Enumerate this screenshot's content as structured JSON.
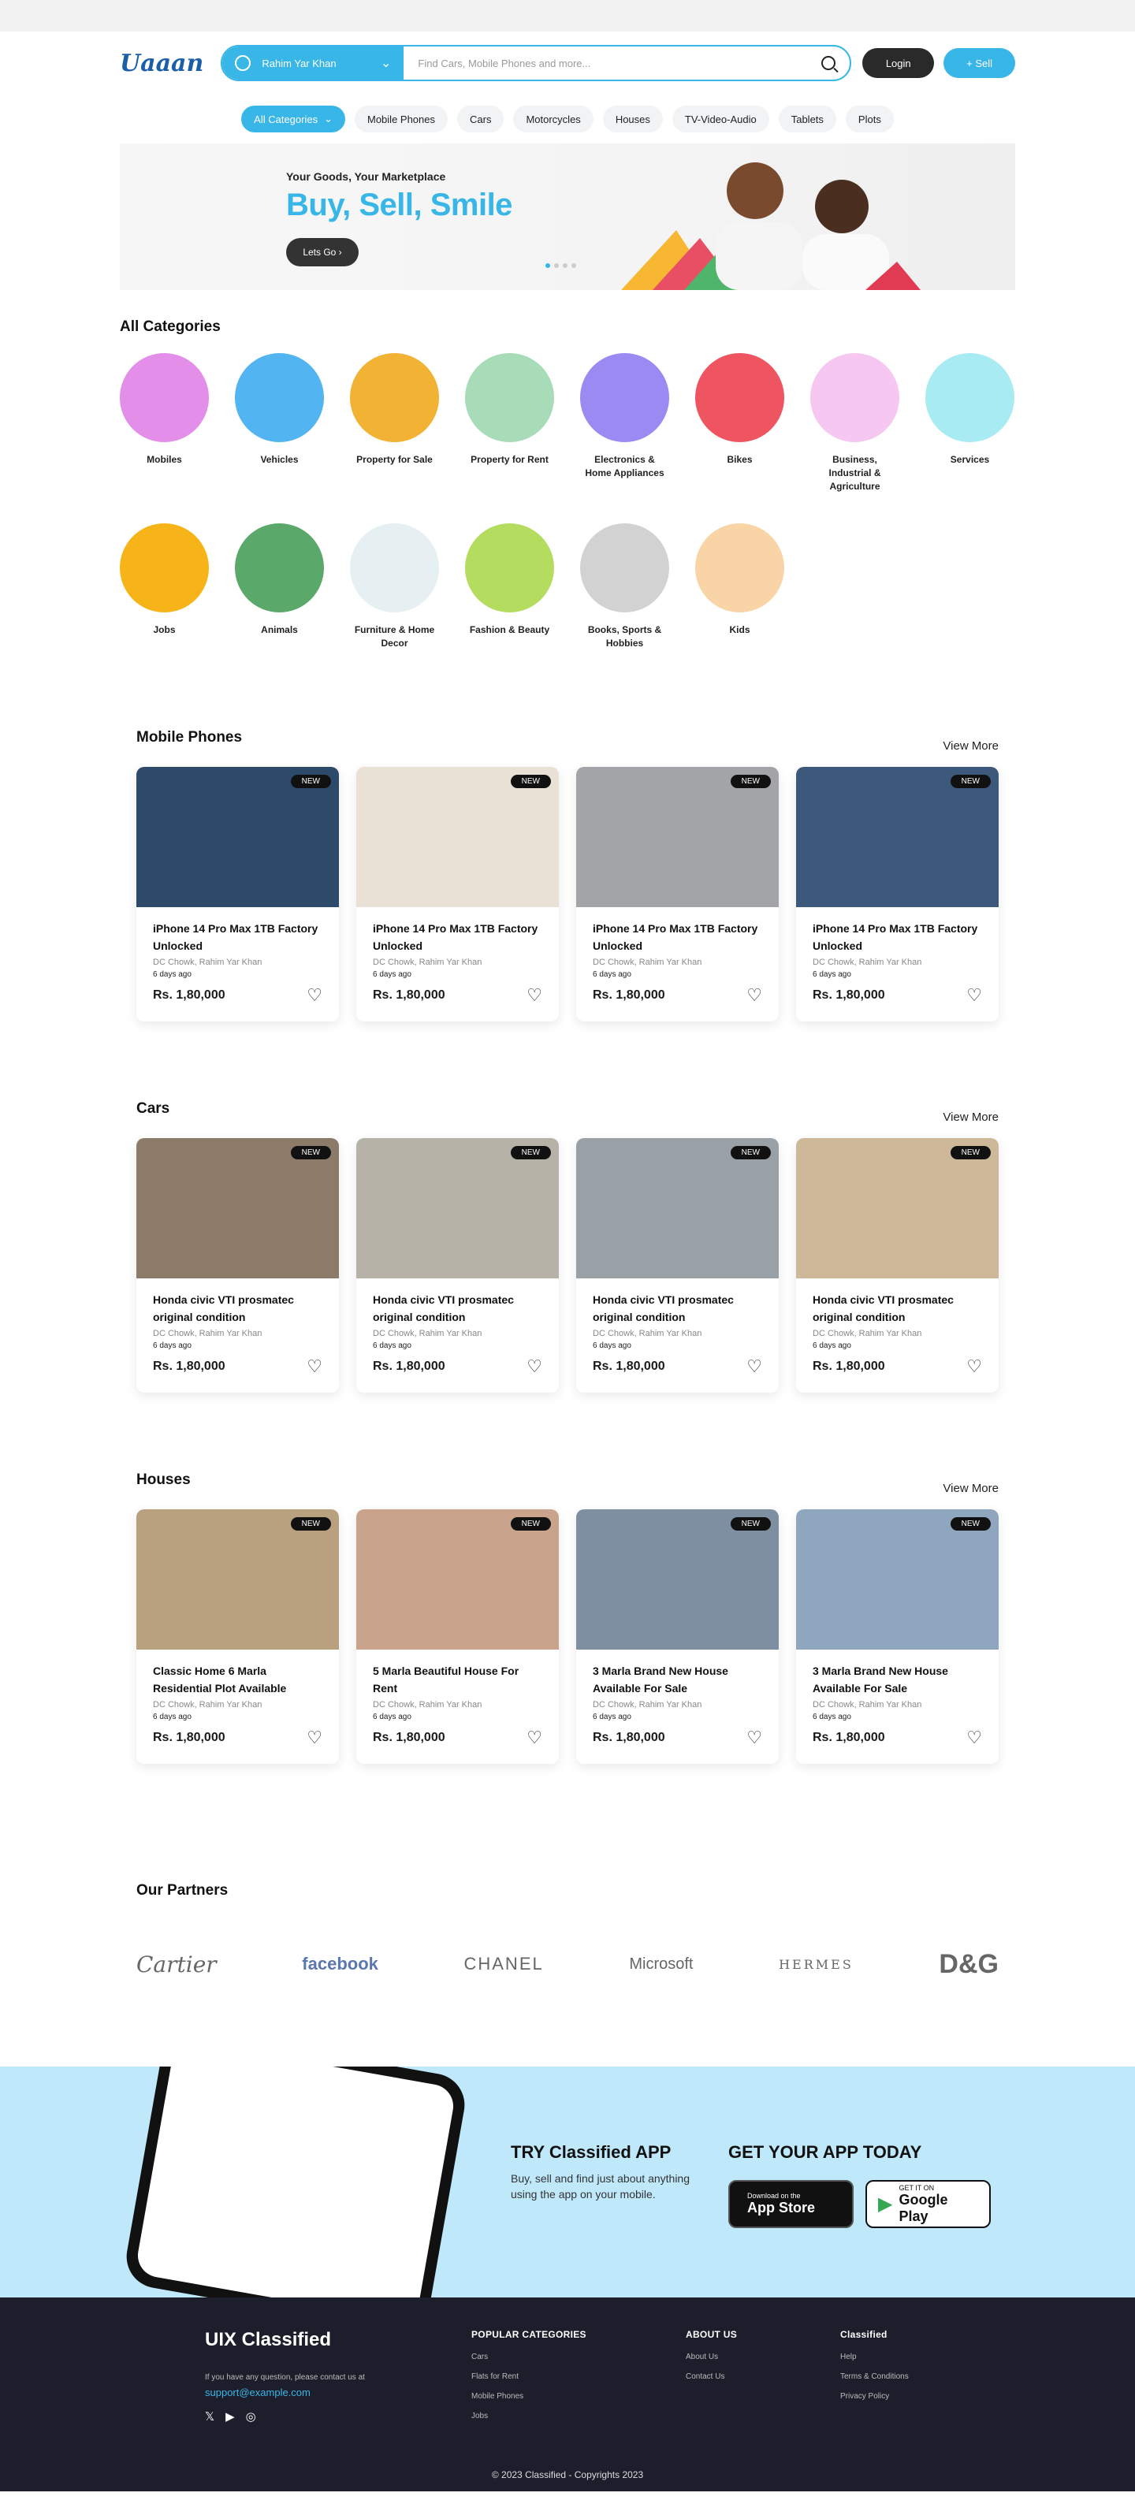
{
  "header": {
    "logo": "Uaaan",
    "location": "Rahim Yar Khan",
    "search_placeholder": "Find Cars, Mobile Phones and more...",
    "login": "Login",
    "sell": "+ Sell"
  },
  "nav": {
    "all": "All Categories",
    "items": [
      "Mobile Phones",
      "Cars",
      "Motorcycles",
      "Houses",
      "TV-Video-Audio",
      "Tablets",
      "Plots"
    ]
  },
  "hero": {
    "tagline": "Your Goods, Your Marketplace",
    "headline": "Buy, Sell, Smile",
    "cta": "Lets Go"
  },
  "categories": {
    "title": "All Categories",
    "items": [
      {
        "label": "Mobiles",
        "color": "#e38ee8"
      },
      {
        "label": "Vehicles",
        "color": "#52b4f0"
      },
      {
        "label": "Property for Sale",
        "color": "#f2b233"
      },
      {
        "label": "Property for Rent",
        "color": "#a8dcb8"
      },
      {
        "label": "Electronics & Home Appliances",
        "color": "#9a8af2"
      },
      {
        "label": "Bikes",
        "color": "#ee5560"
      },
      {
        "label": "Business, Industrial & Agriculture",
        "color": "#f6c8f1"
      },
      {
        "label": "Services",
        "color": "#a9ebf3"
      },
      {
        "label": "Jobs",
        "color": "#f6b419"
      },
      {
        "label": "Animals",
        "color": "#5aa86a"
      },
      {
        "label": "Furniture & Home Decor",
        "color": "#e6eff1"
      },
      {
        "label": "Fashion & Beauty",
        "color": "#b4dc5e"
      },
      {
        "label": "Books, Sports & Hobbies",
        "color": "#d2d2d2"
      },
      {
        "label": "Kids",
        "color": "#f9d4a6"
      }
    ]
  },
  "sections": [
    {
      "title": "Mobile Phones",
      "view_more": "View More",
      "items": [
        {
          "title": "iPhone 14 Pro Max 1TB Factory Unlocked",
          "location": "DC Chowk, Rahim Yar Khan",
          "ago": "6 days ago",
          "price": "Rs. 1,80,000",
          "badge": "NEW",
          "color": "#2d4a6b"
        },
        {
          "title": "iPhone 14 Pro Max 1TB Factory Unlocked",
          "location": "DC Chowk, Rahim Yar Khan",
          "ago": "6 days ago",
          "price": "Rs. 1,80,000",
          "badge": "NEW",
          "color": "#e9e1d6"
        },
        {
          "title": "iPhone 14 Pro Max 1TB Factory Unlocked",
          "location": "DC Chowk, Rahim Yar Khan",
          "ago": "6 days ago",
          "price": "Rs. 1,80,000",
          "badge": "NEW",
          "color": "#a3a4a7"
        },
        {
          "title": "iPhone 14 Pro Max 1TB Factory Unlocked",
          "location": "DC Chowk, Rahim Yar Khan",
          "ago": "6 days ago",
          "price": "Rs. 1,80,000",
          "badge": "NEW",
          "color": "#3c587a"
        }
      ]
    },
    {
      "title": "Cars",
      "view_more": "View More",
      "items": [
        {
          "title": "Honda civic VTI prosmatec original condition",
          "location": "DC Chowk, Rahim Yar Khan",
          "ago": "6 days ago",
          "price": "Rs. 1,80,000",
          "badge": "NEW",
          "color": "#8b7b68"
        },
        {
          "title": "Honda civic VTI prosmatec original condition",
          "location": "DC Chowk, Rahim Yar Khan",
          "ago": "6 days ago",
          "price": "Rs. 1,80,000",
          "badge": "NEW",
          "color": "#b6b2a8"
        },
        {
          "title": "Honda civic VTI prosmatec original condition",
          "location": "DC Chowk, Rahim Yar Khan",
          "ago": "6 days ago",
          "price": "Rs. 1,80,000",
          "badge": "NEW",
          "color": "#9aa1a6"
        },
        {
          "title": "Honda civic VTI prosmatec original condition",
          "location": "DC Chowk, Rahim Yar Khan",
          "ago": "6 days ago",
          "price": "Rs. 1,80,000",
          "badge": "NEW",
          "color": "#cdb89a"
        }
      ]
    },
    {
      "title": "Houses",
      "view_more": "View More",
      "items": [
        {
          "title": "Classic Home 6 Marla Residential Plot Available",
          "location": "DC Chowk, Rahim Yar Khan",
          "ago": "6 days ago",
          "price": "Rs. 1,80,000",
          "badge": "NEW",
          "color": "#b9a07e"
        },
        {
          "title": "5 Marla Beautiful House For Rent",
          "location": "DC Chowk, Rahim Yar Khan",
          "ago": "6 days ago",
          "price": "Rs. 1,80,000",
          "badge": "NEW",
          "color": "#c9a38c"
        },
        {
          "title": "3 Marla Brand New House Available For Sale",
          "location": "DC Chowk, Rahim Yar Khan",
          "ago": "6 days ago",
          "price": "Rs. 1,80,000",
          "badge": "NEW",
          "color": "#7d8fa0"
        },
        {
          "title": "3 Marla Brand New House Available For Sale",
          "location": "DC Chowk, Rahim Yar Khan",
          "ago": "6 days ago",
          "price": "Rs. 1,80,000",
          "badge": "NEW",
          "color": "#8fa6bf"
        }
      ]
    }
  ],
  "partners": {
    "title": "Our Partners",
    "items": [
      "Cartier",
      "facebook",
      "CHANEL",
      "Microsoft",
      "HERMES",
      "D&G"
    ]
  },
  "app": {
    "try_title": "TRY Classified APP",
    "try_text": "Buy, sell and find just about anything using the app on your mobile.",
    "get_title": "GET YOUR APP TODAY",
    "appstore_small": "Download on the",
    "appstore_big": "App Store",
    "play_small": "GET IT ON",
    "play_big": "Google Play"
  },
  "footer": {
    "logo": "UIX Classified",
    "note": "If you have any question, please contact us at",
    "email": "support@example.com",
    "cols": [
      {
        "title": "POPULAR CATEGORIES",
        "links": [
          "Cars",
          "Flats for Rent",
          "Mobile Phones",
          "Jobs"
        ]
      },
      {
        "title": "ABOUT US",
        "links": [
          "About Us",
          "Contact Us"
        ]
      },
      {
        "title": "Classified",
        "links": [
          "Help",
          "Terms & Conditions",
          "Privacy Policy"
        ]
      }
    ],
    "copyright": "© 2023 Classified - Copyrights 2023"
  },
  "colors": {
    "accent": "#38b6e8",
    "dark": "#2a2a2a",
    "footer": "#1c1f2b",
    "appband": "#bfe8fb"
  }
}
